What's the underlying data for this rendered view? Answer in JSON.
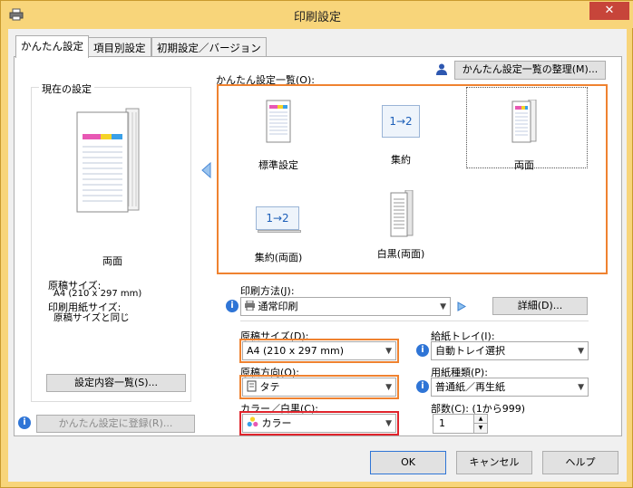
{
  "window": {
    "title": "印刷設定",
    "close_glyph": "✕"
  },
  "tabs": [
    {
      "label": "かんたん設定"
    },
    {
      "label": "項目別設定"
    },
    {
      "label": "初期設定／バージョン"
    }
  ],
  "current": {
    "group_label": "現在の設定",
    "preview_caption": "両面",
    "lines": [
      "原稿サイズ:",
      "A4 (210 x 297 mm)",
      "印刷用紙サイズ:",
      "原稿サイズと同じ"
    ],
    "list_button": "設定内容一覧(S)..."
  },
  "register_button": "かんたん設定に登録(R)...",
  "quick": {
    "label": "かんたん設定一覧(O):",
    "organize_button": "かんたん設定一覧の整理(M)...",
    "items": [
      {
        "label": "標準設定"
      },
      {
        "label": "集約"
      },
      {
        "label": "両面"
      },
      {
        "label": "集約(両面)"
      },
      {
        "label": "白黒(両面)"
      }
    ],
    "nup_glyph": "1→2"
  },
  "print_method": {
    "label": "印刷方法(J):",
    "value": "通常印刷",
    "detail_button": "詳細(D)..."
  },
  "original_size": {
    "label": "原稿サイズ(D):",
    "value": "A4 (210 x 297 mm)"
  },
  "orientation": {
    "label": "原稿方向(O):",
    "value": "タテ"
  },
  "color": {
    "label": "カラー／白黒(C):",
    "value": "カラー"
  },
  "tray": {
    "label": "給紙トレイ(I):",
    "value": "自動トレイ選択"
  },
  "paper_type": {
    "label": "用紙種類(P):",
    "value": "普通紙／再生紙"
  },
  "copies": {
    "label": "部数(C): (1から999)",
    "value": "1"
  },
  "footer": {
    "ok": "OK",
    "cancel": "キャンセル",
    "help": "ヘルプ"
  },
  "icons": {
    "info": "i",
    "dropdown": "▼"
  },
  "colors": {
    "accent_orange": "#ef8230",
    "accent_red": "#e0242c",
    "title_bar": "#f8d57a"
  }
}
